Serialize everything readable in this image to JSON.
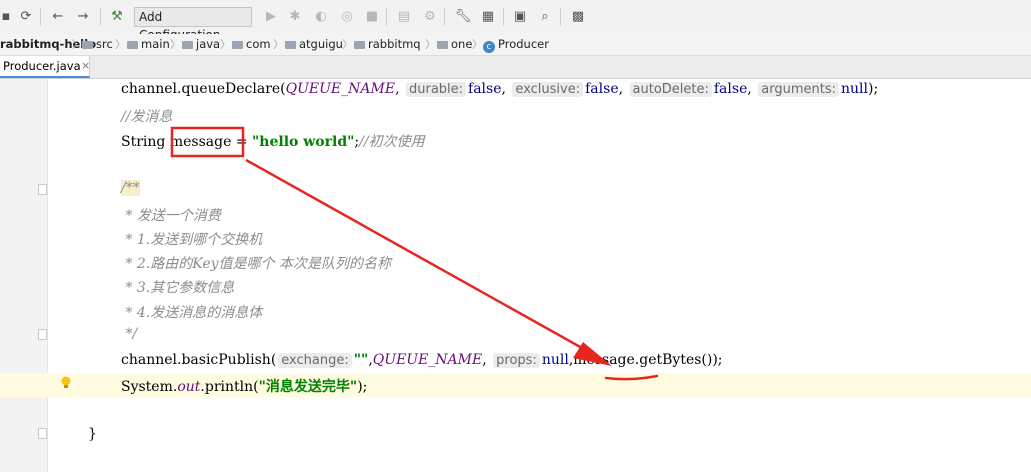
{
  "toolbar": {
    "run_config": "Add Configuration...",
    "icons": [
      "save-icon",
      "sync-icon",
      "back-icon",
      "forward-icon",
      "build-hammer-icon",
      "run-icon",
      "debug-icon",
      "coverage-icon",
      "profile-icon",
      "stop-icon",
      "update-icon",
      "attach-icon",
      "settings-wrench-icon",
      "project-structure-icon",
      "terminal-icon",
      "search-icon",
      "vcs-icon"
    ]
  },
  "breadcrumbs": [
    "rabbitmq-hello",
    "src",
    "main",
    "java",
    "com",
    "atguigu",
    "rabbitmq",
    "one",
    "Producer"
  ],
  "tab": {
    "label": "Producer.java"
  },
  "code": {
    "l1_a": "channel.queueDeclare(",
    "l1_queue": "QUEUE_NAME",
    "l1_h1": "durable:",
    "l1_v1": "false",
    "l1_h2": "exclusive:",
    "l1_v2": "false",
    "l1_h3": "autoDelete:",
    "l1_v3": "false",
    "l1_h4": "arguments:",
    "l1_v4": "null",
    "l1_end": ");",
    "l2": "//发消息",
    "l3_a": "String ",
    "l3_var": "message",
    "l3_eq": " = ",
    "l3_str": "\"hello world\"",
    "l3_semi": ";",
    "l3_cmt": "//初次使用",
    "d1": "/**",
    "d2": " * 发送一个消费",
    "d3": " * 1.发送到哪个交换机",
    "d4": " * 2.路由的Key值是哪个 本次是队列的名称",
    "d5": " * 3.其它参数信息",
    "d6": " * 4.发送消息的消息体",
    "d7": " */",
    "p_a": "channel.basicPublish(",
    "p_h1": "exchange:",
    "p_v1": "\"\"",
    "p_comma": ",",
    "p_queue": "QUEUE_NAME",
    "p_h2": "props:",
    "p_v2": "null",
    "p_msg": "message",
    "p_end": ".getBytes());",
    "s_a": "System.",
    "s_out": "out",
    "s_b": ".println(",
    "s_str": "\"消息发送完毕\"",
    "s_end": ");",
    "brace": "}"
  },
  "colors": {
    "annotation": "#e8261f",
    "string": "#008000",
    "constant": "#660e7a",
    "comment": "#8c8c8c",
    "current_line": "#fffbe1"
  }
}
